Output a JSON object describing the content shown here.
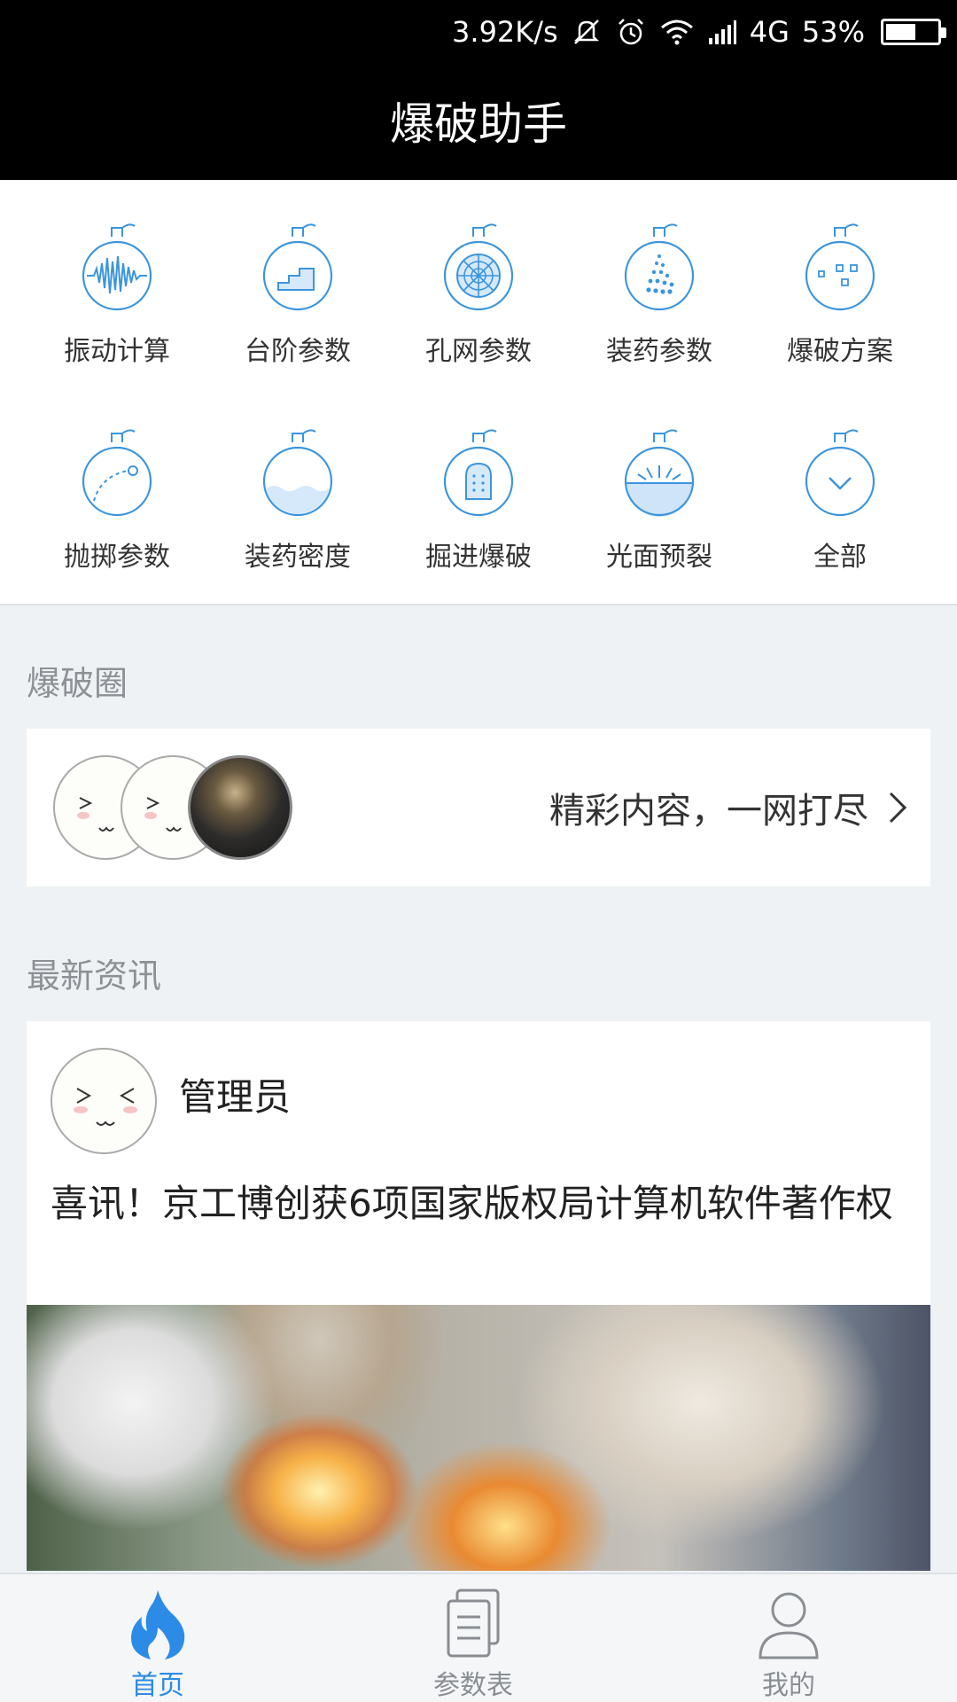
{
  "status_bar": {
    "speed": "3.92K/s",
    "network": "4G",
    "battery": "53%",
    "icons": [
      "mute-icon",
      "alarm-icon",
      "wifi-icon",
      "signal-icon",
      "battery-icon"
    ]
  },
  "app_bar": {
    "title": "爆破助手"
  },
  "features": [
    {
      "label": "振动计算",
      "icon": "vibration-flask-icon"
    },
    {
      "label": "台阶参数",
      "icon": "steps-flask-icon"
    },
    {
      "label": "孔网参数",
      "icon": "hole-grid-flask-icon"
    },
    {
      "label": "装药参数",
      "icon": "charge-dots-flask-icon"
    },
    {
      "label": "爆破方案",
      "icon": "blast-plan-flask-icon"
    },
    {
      "label": "抛掷参数",
      "icon": "throw-trajectory-flask-icon"
    },
    {
      "label": "装药密度",
      "icon": "charge-density-flask-icon"
    },
    {
      "label": "掘进爆破",
      "icon": "tunnel-flask-icon"
    },
    {
      "label": "光面预裂",
      "icon": "presplit-flask-icon"
    },
    {
      "label": "全部",
      "icon": "chevron-down-flask-icon"
    }
  ],
  "circle_section": {
    "title": "爆破圈",
    "link_text": "精彩内容，一网打尽"
  },
  "news_section": {
    "title": "最新资讯",
    "author": "管理员",
    "headline": "喜讯！京工博创获6项国家版权局计算机软件著作权"
  },
  "bottom_nav": [
    {
      "label": "首页",
      "icon": "flame-icon",
      "active": true
    },
    {
      "label": "参数表",
      "icon": "document-icon",
      "active": false
    },
    {
      "label": "我的",
      "icon": "user-icon",
      "active": false
    }
  ],
  "colors": {
    "accent": "#2b8be6",
    "icon_blue": "#3b95de",
    "background": "#eef2f5"
  }
}
